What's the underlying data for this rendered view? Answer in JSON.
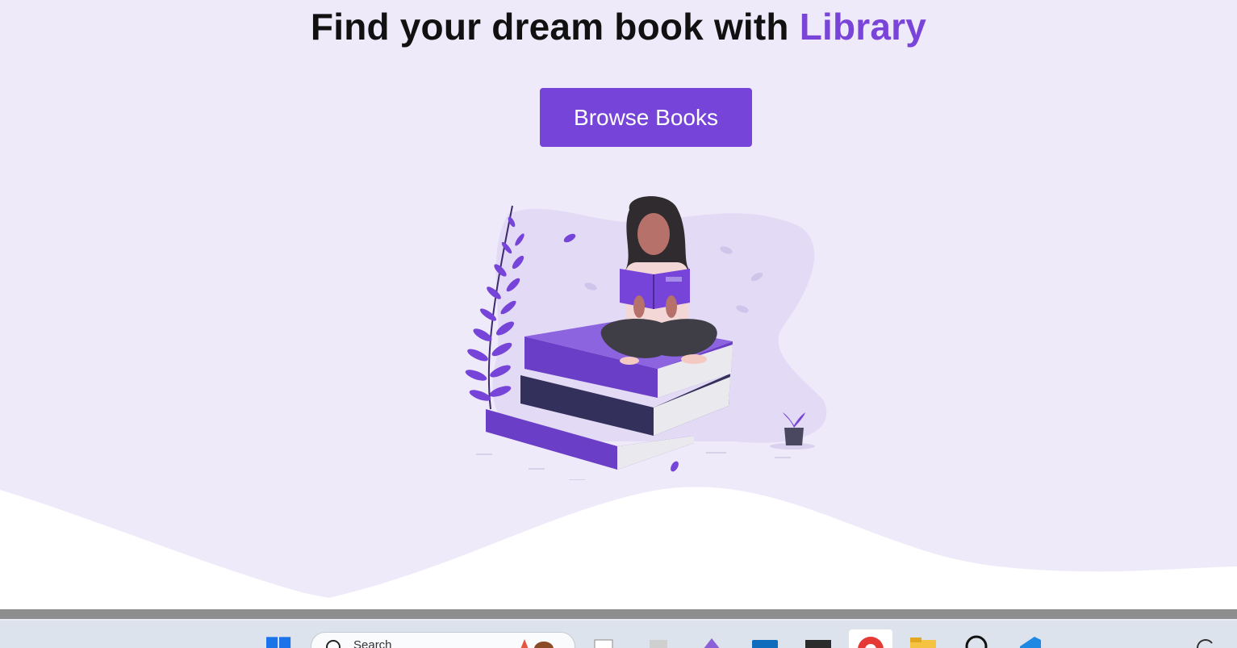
{
  "hero": {
    "title_prefix": "Find your dream book with ",
    "title_accent": "Library",
    "browse_button_label": "Browse Books",
    "illustration": "woman-reading-on-book-stack-illustration"
  },
  "colors": {
    "accent": "#7644d8",
    "hero_background": "#efeafa",
    "wave": "#ffffff",
    "taskbar_background": "#dde3ec"
  },
  "taskbar": {
    "search_placeholder": "Search",
    "items": [
      {
        "name": "windows-start-icon"
      },
      {
        "name": "task-view-icon"
      },
      {
        "name": "app-icon"
      },
      {
        "name": "visual-studio-icon"
      },
      {
        "name": "outlook-icon"
      },
      {
        "name": "terminal-icon"
      },
      {
        "name": "chrome-icon",
        "active": true
      },
      {
        "name": "file-explorer-icon"
      },
      {
        "name": "chatgpt-icon"
      },
      {
        "name": "vscode-icon"
      }
    ]
  }
}
